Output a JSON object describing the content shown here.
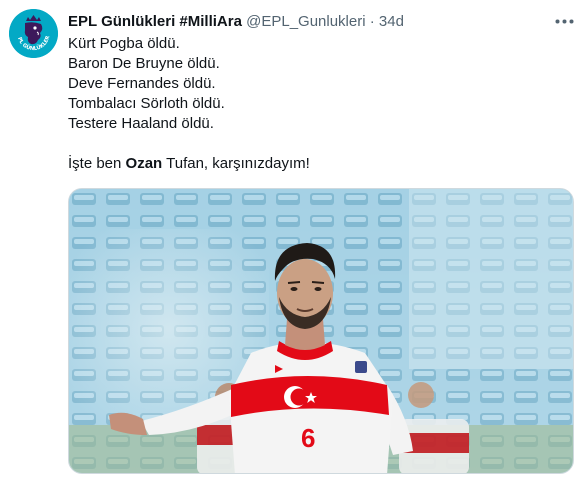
{
  "tweet": {
    "display_name": "EPL Günlükleri #MilliAra",
    "handle": "@EPL_Gunlukleri",
    "separator": "·",
    "time": "34d",
    "lines": [
      "Kürt Pogba öldü.",
      "Baron De Bruyne öldü.",
      "Deve Fernandes öldü.",
      "Tombalacı Sörloth öldü.",
      "Testere Haaland öldü."
    ],
    "final_prefix": "İşte ben ",
    "final_bold": "Ozan",
    "final_suffix": " Tufan, karşınızdayım!",
    "avatar_text": "EPL GÜNLÜKLERİ",
    "jersey_number": "6"
  },
  "colors": {
    "avatar_bg": "#03a9c5",
    "jersey_red": "#e30a17",
    "muted": "#536471"
  },
  "icons": {
    "more": "more-options-icon",
    "avatar": "lion-logo-icon"
  }
}
